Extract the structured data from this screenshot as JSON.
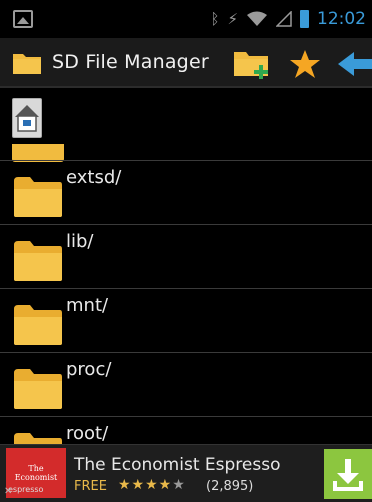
{
  "status_bar": {
    "time": "12:02",
    "icons": [
      "screenshot-icon",
      "vibrate-icon",
      "bluetooth-icon",
      "wifi-icon",
      "signal-icon",
      "battery-icon"
    ],
    "accent_color": "#3a9bd9"
  },
  "action_bar": {
    "title": "SD File Manager",
    "actions": [
      "new-folder-icon",
      "favorites-star-icon",
      "back-arrow-icon"
    ]
  },
  "list": {
    "items": [
      {
        "name": "extsd/"
      },
      {
        "name": "lib/"
      },
      {
        "name": "mnt/"
      },
      {
        "name": "proc/"
      },
      {
        "name": "root/"
      }
    ],
    "folder_color": "#f1bb3f"
  },
  "ad": {
    "logo_text": "The Economist",
    "logo_sub": "espresso",
    "title": "The Economist Espresso",
    "price": "FREE",
    "rating": 4.0,
    "stars": "★★★★",
    "stars_dim": "★",
    "review_count": "(2,895)",
    "logo_color": "#d32b2b",
    "download_color": "#8cc63f"
  }
}
